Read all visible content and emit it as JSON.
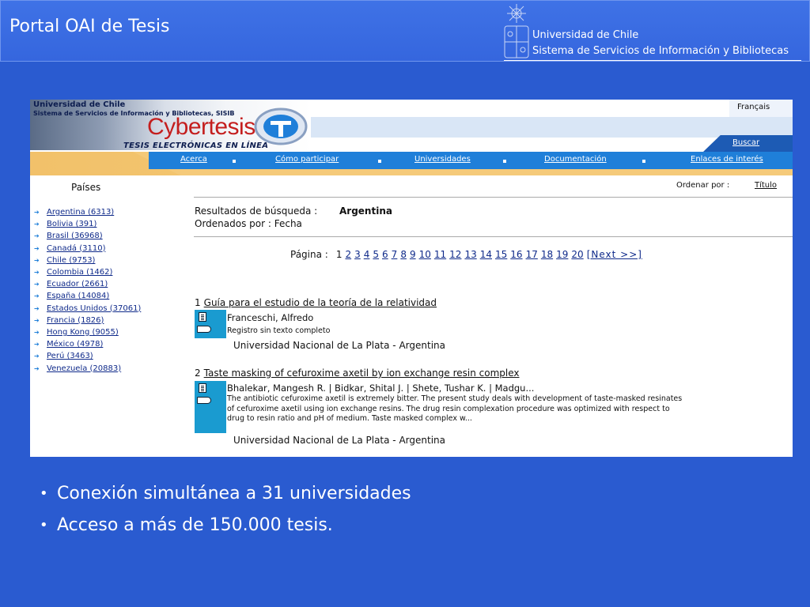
{
  "slide": {
    "title": "Portal OAI de Tesis",
    "org_line1": "Universidad de Chile",
    "org_line2": "Sistema de Servicios de Información y Bibliotecas",
    "bullets": [
      "Conexión simultánea a 31 universidades",
      "Acceso a más de 150.000 tesis."
    ]
  },
  "site": {
    "university": "Universidad de Chile",
    "system": "Sistema de Servicios de Información y Bibliotecas, SISIB",
    "brand": "Cybertesis",
    "tagline": "TESIS ELECTRÓNICAS EN LÍNEA",
    "language_link": "Français",
    "search_link": "Buscar",
    "nav": [
      "Acerca",
      "Cómo participar",
      "Universidades",
      "Documentación",
      "Enlaces de interés"
    ]
  },
  "sidebar": {
    "title": "Países",
    "countries": [
      "Argentina (6313)",
      "Bolivia (391)",
      "Brasil (36968)",
      "Canadá (3110)",
      "Chile (9753)",
      "Colombia (1462)",
      "Ecuador (2661)",
      "España (14084)",
      "Estados Unidos (37061)",
      "Francia (1826)",
      "Hong Kong (9055)",
      "México (4978)",
      "Perú (3463)",
      "Venezuela (20883)"
    ]
  },
  "results": {
    "sort_label": "Ordenar por :",
    "sort_link": "Título",
    "search_label": "Resultados de búsqueda :",
    "search_value": "Argentina",
    "ordered_by": "Ordenados por : Fecha",
    "page_label": "Página :",
    "current_page": "1",
    "pages": [
      "2",
      "3",
      "4",
      "5",
      "6",
      "7",
      "8",
      "9",
      "10",
      "11",
      "12",
      "13",
      "14",
      "15",
      "16",
      "17",
      "18",
      "19",
      "20"
    ],
    "next_label": "[Next >>]",
    "records": [
      {
        "number": "1",
        "title": "Guía para el estudio de la teoría de la relatividad",
        "authors": "Franceschi, Alfredo",
        "note": "Registro sin texto completo",
        "institution": "Universidad Nacional de La Plata - Argentina"
      },
      {
        "number": "2",
        "title": "Taste masking of cefuroxime axetil by ion exchange resin complex",
        "authors": "Bhalekar, Mangesh R. | Bidkar, Shital J. | Shete, Tushar K. | Madgu...",
        "note": "The antibiotic cefuroxime axetil is extremely bitter. The present study deals with development of taste-masked resinates of cefuroxime axetil using ion exchange resins. The drug resin complexation procedure was optimized with respect to drug to resin ratio and pH of medium. Taste masked complex w...",
        "institution": "Universidad Nacional de La Plata - Argentina"
      }
    ]
  }
}
